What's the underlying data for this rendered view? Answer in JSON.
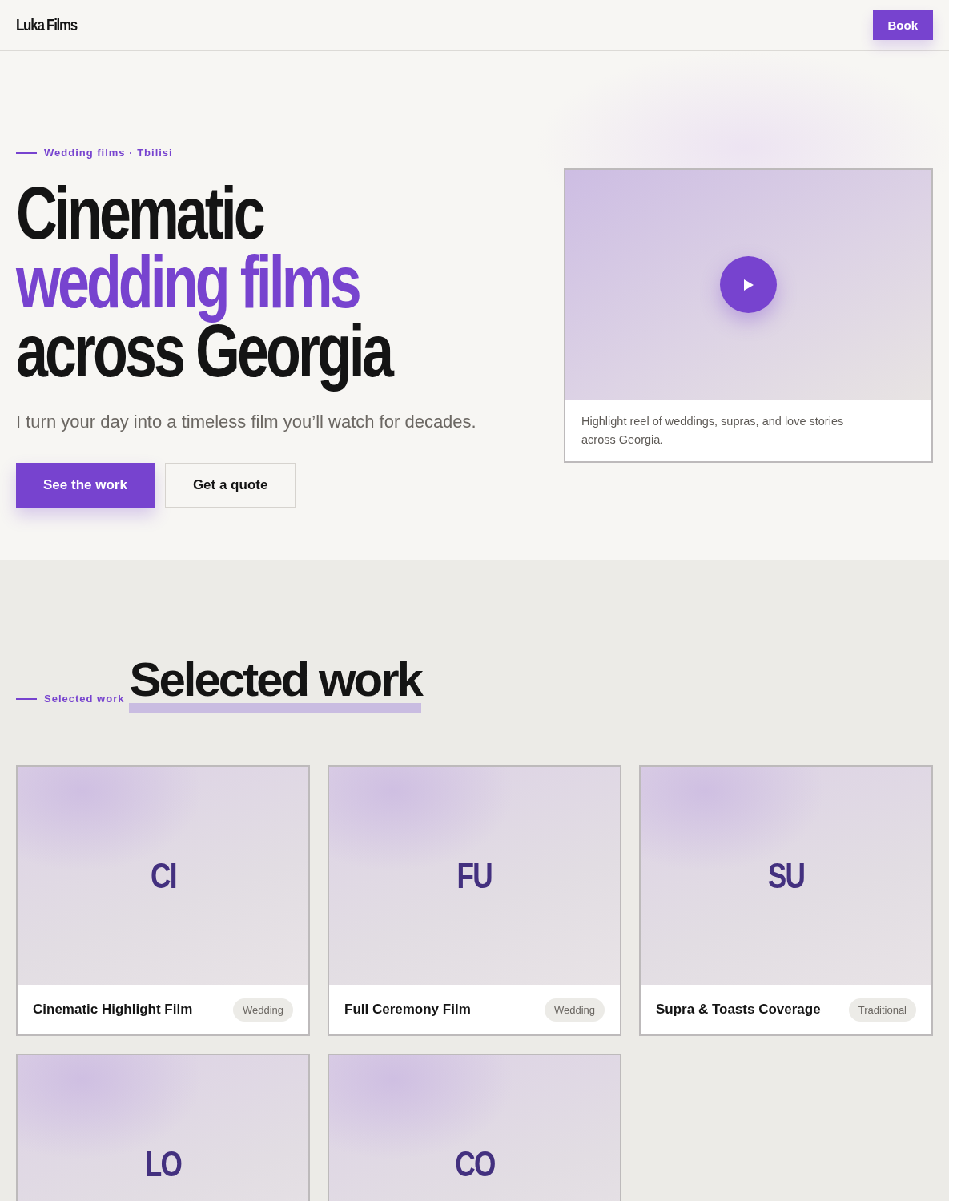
{
  "header": {
    "logo": "Luka Films",
    "book_button": "Book"
  },
  "hero": {
    "eyebrow": "Wedding films · Tbilisi",
    "title_lines": [
      {
        "text": "Cinematic",
        "accent": false
      },
      {
        "text": "wedding films",
        "accent": true
      },
      {
        "text": "across Georgia",
        "accent": false
      }
    ],
    "subtitle": "I turn your day into a timeless film you’ll watch for decades.",
    "buttons": [
      {
        "label": "See the work",
        "kind": "primary"
      },
      {
        "label": "Get a quote",
        "kind": "secondary"
      }
    ],
    "video": {
      "caption": "Highlight reel of weddings, supras, and love stories across Georgia."
    }
  },
  "work": {
    "eyebrow": "Selected work",
    "title": "Selected work",
    "items": [
      {
        "initials": "CI",
        "title": "Cinematic Highlight Film",
        "tag": "Wedding"
      },
      {
        "initials": "FU",
        "title": "Full Ceremony Film",
        "tag": "Wedding"
      },
      {
        "initials": "SU",
        "title": "Supra & Toasts Coverage",
        "tag": "Traditional"
      },
      {
        "initials": "LO"
      },
      {
        "initials": "CO"
      }
    ]
  }
}
